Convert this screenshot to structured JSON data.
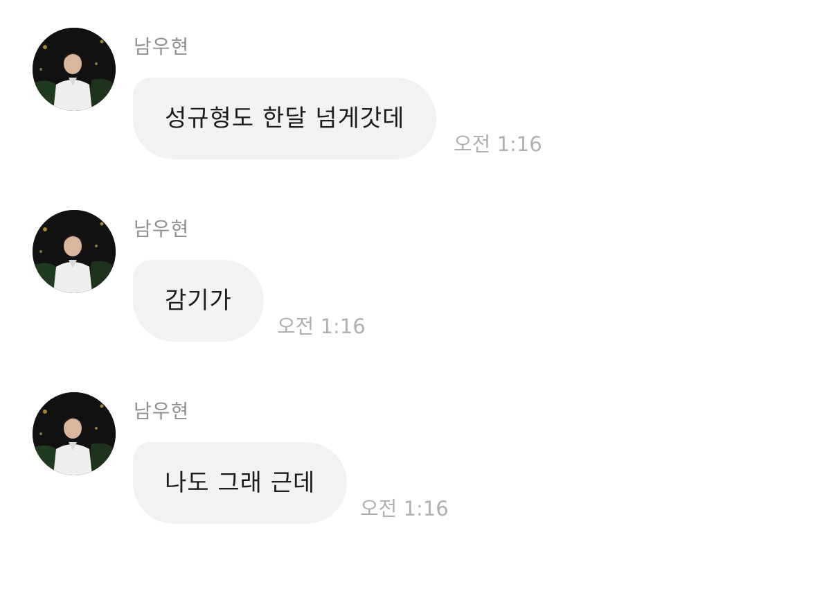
{
  "messages": [
    {
      "sender": "남우현",
      "avatar_icon": "profile-photo",
      "text": "성규형도 한달 넘게갓데",
      "time": "오전 1:16"
    },
    {
      "sender": "남우현",
      "avatar_icon": "profile-photo",
      "text": "감기가",
      "time": "오전 1:16"
    },
    {
      "sender": "남우현",
      "avatar_icon": "profile-photo",
      "text": "나도 그래 근데",
      "time": "오전 1:16"
    }
  ],
  "colors": {
    "bubble_bg": "#f2f2f5",
    "sender_name": "#8e8e93",
    "timestamp": "#b0b0b4",
    "message_text": "#1c1c1e"
  }
}
